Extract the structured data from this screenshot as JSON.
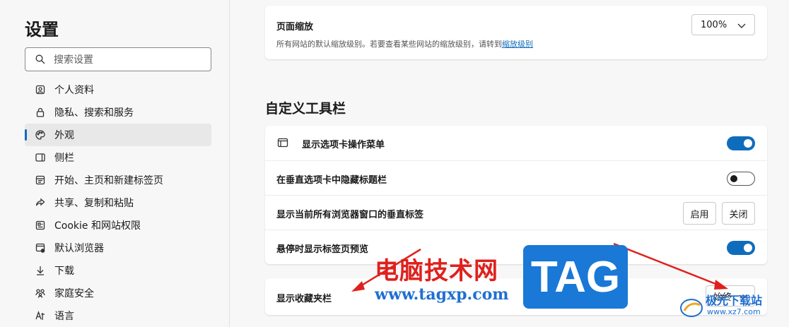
{
  "sidebar": {
    "title": "设置",
    "search_placeholder": "搜索设置",
    "items": [
      {
        "label": "个人资料",
        "icon": "profile-icon"
      },
      {
        "label": "隐私、搜索和服务",
        "icon": "lock-icon"
      },
      {
        "label": "外观",
        "icon": "palette-icon",
        "active": true
      },
      {
        "label": "侧栏",
        "icon": "sidebar-icon"
      },
      {
        "label": "开始、主页和新建标签页",
        "icon": "home-icon"
      },
      {
        "label": "共享、复制和粘贴",
        "icon": "share-icon"
      },
      {
        "label": "Cookie 和网站权限",
        "icon": "permissions-icon"
      },
      {
        "label": "默认浏览器",
        "icon": "browser-icon"
      },
      {
        "label": "下载",
        "icon": "download-icon"
      },
      {
        "label": "家庭安全",
        "icon": "family-icon"
      },
      {
        "label": "语言",
        "icon": "language-icon"
      }
    ]
  },
  "zoom": {
    "title": "页面缩放",
    "description": "所有网站的默认缩放级别。若要查看某些网站的缩放级别，请转到",
    "link": "缩放级别",
    "value": "100%"
  },
  "toolbar_section": {
    "title": "自定义工具栏",
    "rows": [
      {
        "label": "显示选项卡操作菜单",
        "toggle": true
      },
      {
        "label": "在垂直选项卡中隐藏标题栏",
        "toggle": false
      },
      {
        "label": "显示当前所有浏览器窗口的垂直标签",
        "buttons": [
          "启用",
          "关闭"
        ]
      },
      {
        "label": "悬停时显示标签页预览",
        "toggle": true
      }
    ]
  },
  "favorites": {
    "label": "显示收藏夹栏",
    "value": "始终"
  },
  "watermark": {
    "cn_text": "电脑技术网",
    "url": "www.tagxp.com",
    "tag": "TAG",
    "site_name": "极光下载站",
    "site_url": "www.xz7.com"
  },
  "colors": {
    "accent": "#0f6cbd",
    "watermark_red": "#e0201c",
    "watermark_blue": "#1a78d6"
  }
}
